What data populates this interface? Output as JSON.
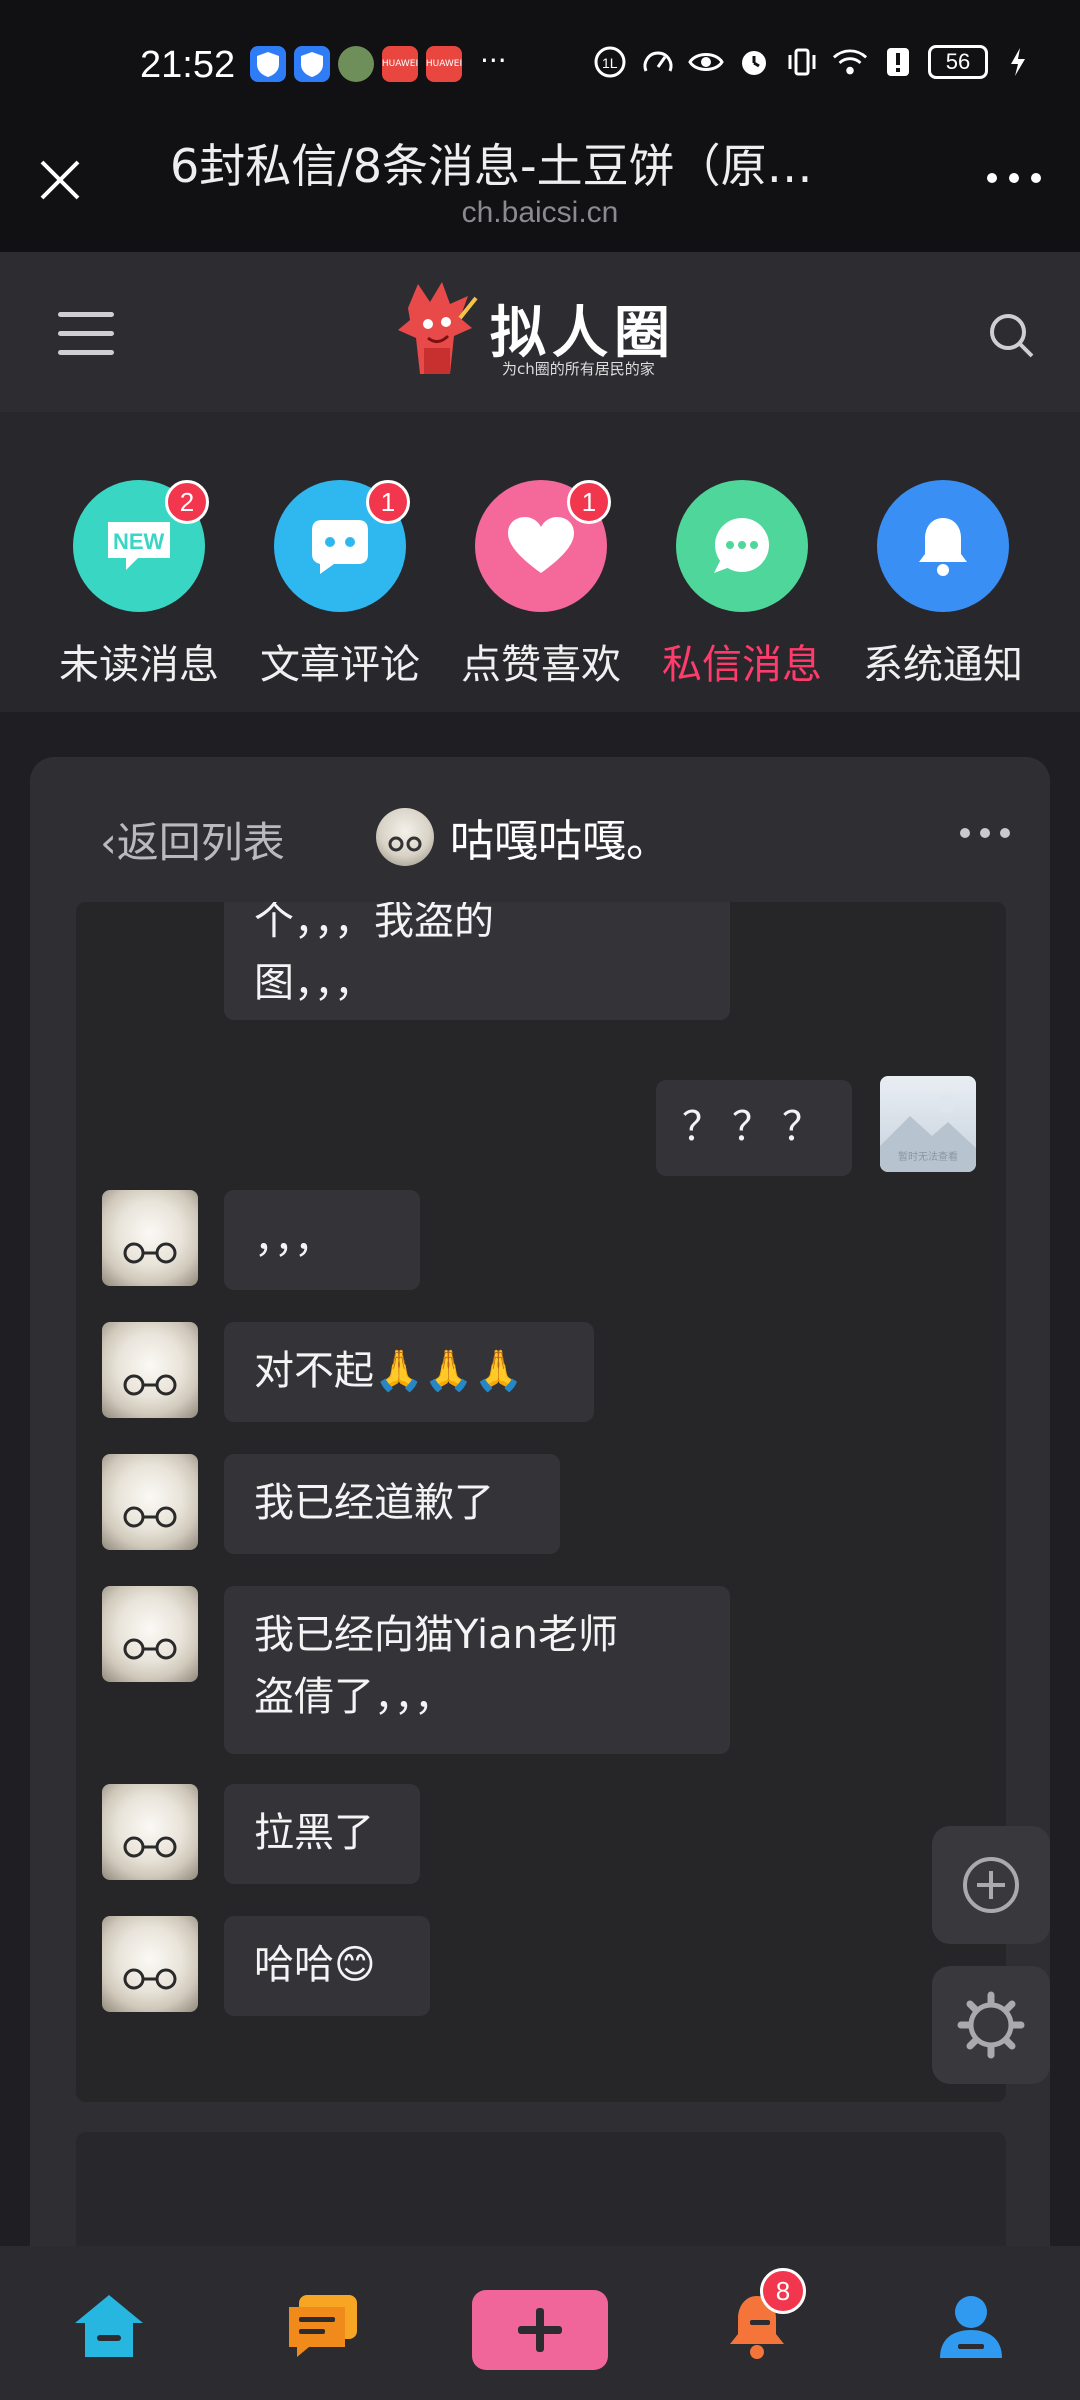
{
  "status_bar": {
    "time": "21:52",
    "app_icons": [
      "shield-icon",
      "shield-icon",
      "game-icon",
      "huawei-app-icon",
      "huawei-app-icon"
    ],
    "app_labels": [
      "",
      "",
      "",
      "HUAWEI",
      "HUAWEI"
    ],
    "more": "···",
    "battery": "56"
  },
  "browser": {
    "title": "6封私信/8条消息-土豆饼（原…",
    "domain": "ch.baicsi.cn"
  },
  "site": {
    "logo_text": "拟人圈",
    "logo_subtitle": "为ch圈的所有居民的家"
  },
  "categories": [
    {
      "label": "未读消息",
      "badge": "2",
      "icon": "new-icon",
      "color": "#3ad6c4"
    },
    {
      "label": "文章评论",
      "badge": "1",
      "icon": "comment-icon",
      "color": "#2fb8f0"
    },
    {
      "label": "点赞喜欢",
      "badge": "1",
      "icon": "heart-icon",
      "color": "#f4699a"
    },
    {
      "label": "私信消息",
      "badge": "",
      "icon": "chat-icon",
      "color": "#4fd69a"
    },
    {
      "label": "系统通知",
      "badge": "",
      "icon": "bell-icon",
      "color": "#3a8ff5"
    }
  ],
  "chat": {
    "back_label": "返回列表",
    "peer_name": "咕嘎咕嘎。",
    "messages": [
      {
        "from": "peer",
        "text": "个，，，我盗的\n图，，，",
        "cut": true
      },
      {
        "from": "me",
        "text": "？？？"
      },
      {
        "from": "peer",
        "text": "，，，"
      },
      {
        "from": "peer",
        "text": "对不起🙏🙏🙏"
      },
      {
        "from": "peer",
        "text": "我已经道歉了"
      },
      {
        "from": "peer",
        "text": "我已经向猫Yian老师\n盗倩了，，，"
      },
      {
        "from": "peer",
        "text": "拉黑了"
      },
      {
        "from": "peer",
        "text": "哈哈😊"
      }
    ],
    "my_avatar_text": "暂时无法查看"
  },
  "bottom_nav": {
    "bell_badge": "8"
  }
}
